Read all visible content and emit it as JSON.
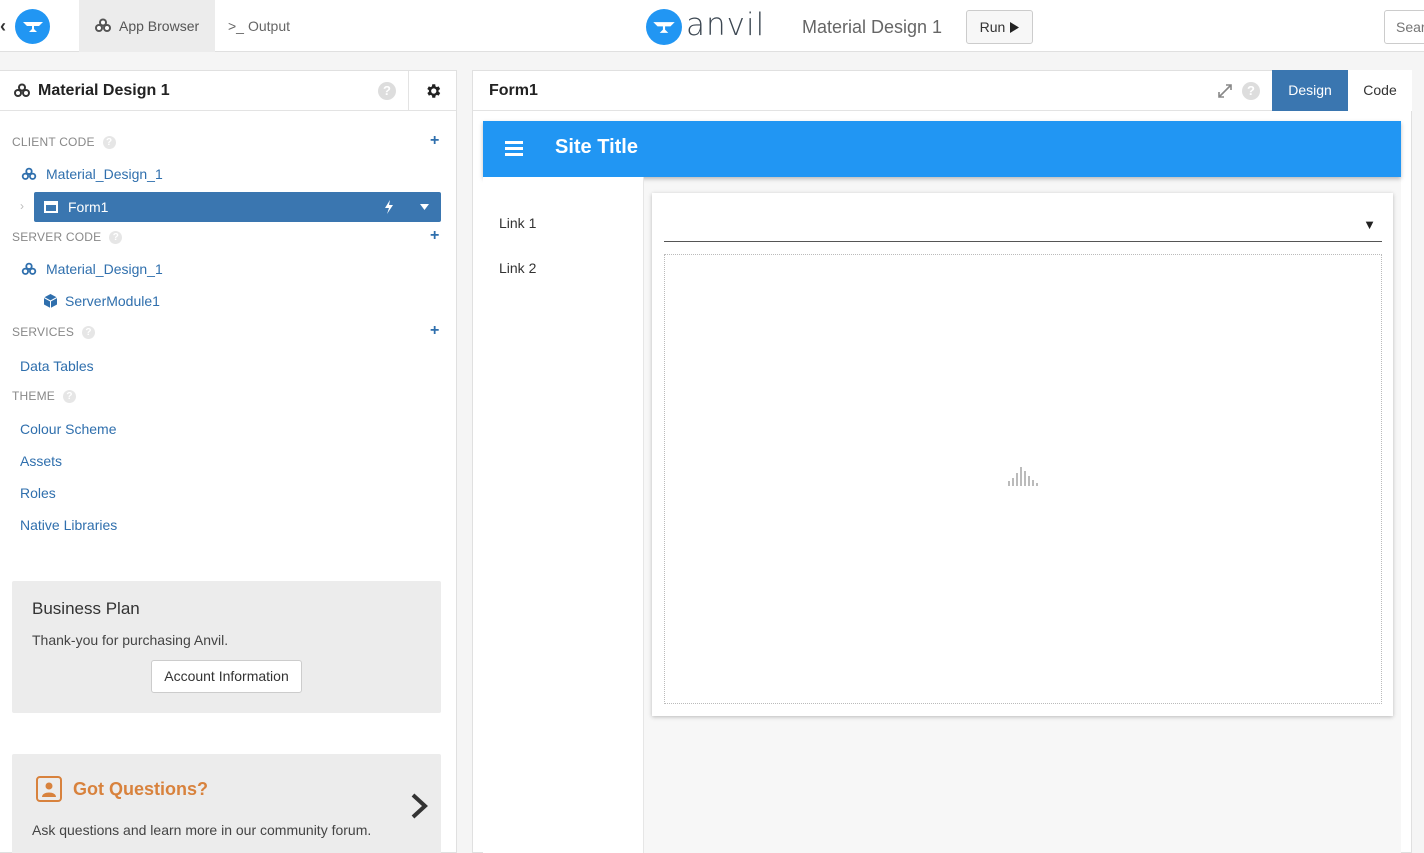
{
  "topbar": {
    "back_glyph": "‹",
    "app_browser_label": "App Browser",
    "output_prompt": ">_",
    "output_label": "Output",
    "brand_word": "anvil",
    "app_name": "Material Design 1",
    "run_label": "Run",
    "search_placeholder": "Sear"
  },
  "left_panel": {
    "title": "Material Design 1",
    "help_glyph": "?",
    "sections": {
      "client_code": {
        "label": "CLIENT CODE",
        "package": "Material_Design_1",
        "form": "Form1"
      },
      "server_code": {
        "label": "SERVER CODE",
        "package": "Material_Design_1",
        "module": "ServerModule1"
      },
      "services": {
        "label": "SERVICES",
        "items": [
          "Data Tables"
        ]
      },
      "theme": {
        "label": "THEME",
        "items": [
          "Colour Scheme",
          "Assets",
          "Roles",
          "Native Libraries"
        ]
      }
    },
    "business_card": {
      "title": "Business Plan",
      "text": "Thank-you for purchasing Anvil.",
      "button": "Account Information"
    },
    "questions_card": {
      "title": "Got Questions?",
      "text": "Ask questions and learn more in our community forum."
    }
  },
  "editor": {
    "title": "Form1",
    "tabs": {
      "design": "Design",
      "code": "Code"
    },
    "preview": {
      "site_title": "Site Title",
      "nav_links": [
        "Link 1",
        "Link 2"
      ],
      "dropdown_caret": "▼"
    }
  },
  "colors": {
    "anvil_blue": "#2196f3",
    "selected_blue": "#3a76b0",
    "link_blue": "#2f6fad",
    "accent_orange": "#d8823d"
  },
  "icons": [
    "anvil-logo-icon",
    "packages-icon",
    "gear-icon",
    "help-icon",
    "plus-icon",
    "form-icon",
    "lightning-icon",
    "caret-down-icon",
    "module-cube-icon",
    "expand-icon",
    "hamburger-icon",
    "plot-placeholder-icon",
    "person-icon",
    "chevron-right-icon",
    "play-icon"
  ]
}
